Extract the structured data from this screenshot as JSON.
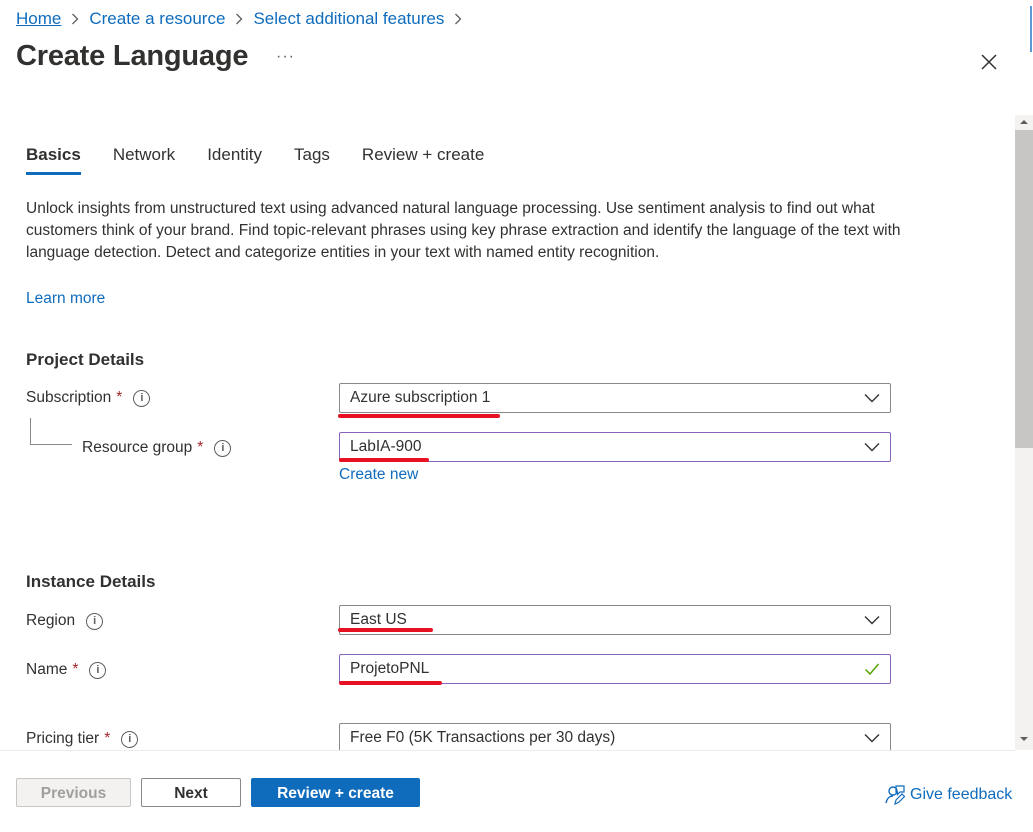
{
  "breadcrumb": {
    "items": [
      "Home",
      "Create a resource",
      "Select additional features"
    ]
  },
  "header": {
    "title": "Create Language",
    "more": "···"
  },
  "tabs": [
    {
      "label": "Basics",
      "active": true
    },
    {
      "label": "Network"
    },
    {
      "label": "Identity"
    },
    {
      "label": "Tags"
    },
    {
      "label": "Review + create"
    }
  ],
  "main": {
    "description": "Unlock insights from unstructured text using advanced natural language processing. Use sentiment analysis to find out what customers think of your brand. Find topic-relevant phrases using key phrase extraction and identify the language of the text with language detection. Detect and categorize entities in your text with named entity recognition.",
    "learn_more": "Learn more"
  },
  "project_details": {
    "heading": "Project Details",
    "subscription_label": "Subscription",
    "subscription_value": "Azure subscription 1",
    "resource_group_label": "Resource group",
    "resource_group_value": "LabIA-900",
    "create_new": "Create new"
  },
  "instance_details": {
    "heading": "Instance Details",
    "region_label": "Region",
    "region_value": "East US",
    "name_label": "Name",
    "name_value": "ProjetoPNL",
    "pricing_label": "Pricing tier",
    "pricing_value": "Free F0 (5K Transactions per 30 days)"
  },
  "footer": {
    "previous": "Previous",
    "next": "Next",
    "review_create": "Review + create",
    "feedback": "Give feedback"
  },
  "colors": {
    "accent": "#0f6cbd",
    "required": "#a4262c",
    "annotation": "#e81123",
    "valid": "#107c10"
  }
}
